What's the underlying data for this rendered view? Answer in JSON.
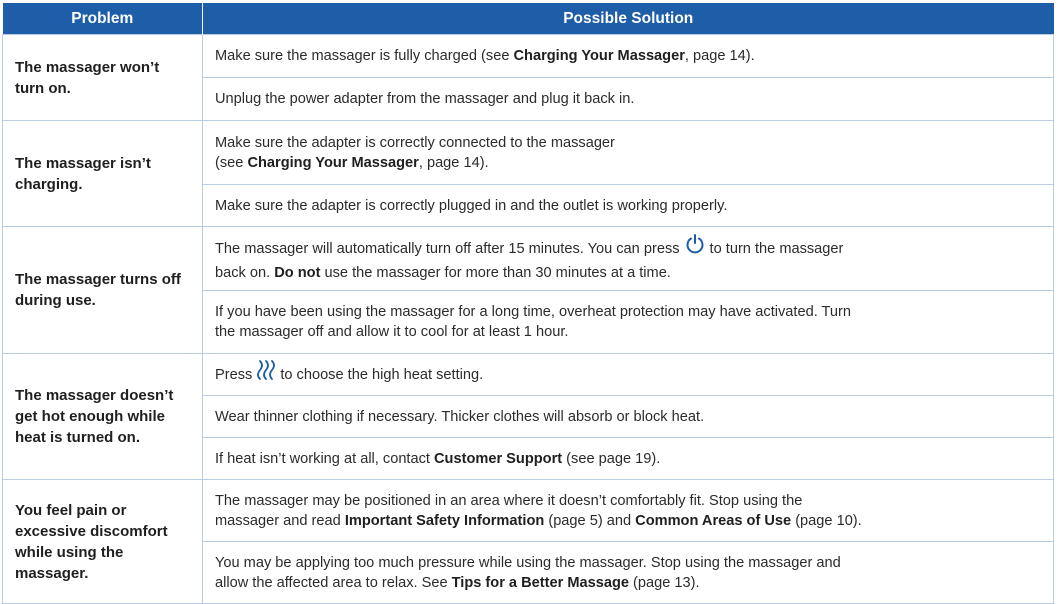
{
  "header": {
    "problem": "Problem",
    "solution": "Possible Solution"
  },
  "rows": [
    {
      "problem": "The massager won’t turn on.",
      "solutions": [
        {
          "t1": "Make sure the massager is fully charged (see ",
          "b1": "Charging Your Massager",
          "t2": ", page 14)."
        },
        {
          "t1": "Unplug the power adapter from the massager and plug it back in."
        }
      ]
    },
    {
      "problem": "The massager isn’t charging.",
      "solutions": [
        {
          "t1": "Make sure the adapter is correctly connected to the massager",
          "t2": "(see ",
          "b1": "Charging Your Massager",
          "t3": ", page 14)."
        },
        {
          "t1": "Make sure the adapter is correctly plugged in and the outlet is working properly."
        }
      ]
    },
    {
      "problem": "The massager turns off during use.",
      "solutions": [
        {
          "t1": "The massager will automatically turn off after 15 minutes. You can press",
          "icon": "power-icon",
          "t2": "to turn the massager",
          "t3": "back on. ",
          "b1": "Do not",
          "t4": " use the massager for more than 30 minutes at a time."
        },
        {
          "t1": "If you have been using the massager for a long time, overheat protection may have activated. Turn",
          "t2": "the massager off and allow it to cool for at least 1 hour."
        }
      ]
    },
    {
      "problem": "The massager doesn’t get hot enough while heat is turned on.",
      "solutions": [
        {
          "t1": "Press",
          "icon": "heat-icon",
          "t2": "to choose the high heat setting."
        },
        {
          "t1": "Wear thinner clothing if necessary. Thicker clothes will absorb or block heat."
        },
        {
          "t1": "If heat isn’t working at all, contact ",
          "b1": "Customer Support",
          "t2": " (see page 19)."
        }
      ]
    },
    {
      "problem": "You feel pain or excessive discomfort while using the massager.",
      "solutions": [
        {
          "t1": "The massager may be positioned in an area where it doesn’t comfortably fit. Stop using the",
          "t2": "massager and read ",
          "b1": "Important Safety Information",
          "t3": " (page 5) and ",
          "b2": "Common Areas of Use",
          "t4": " (page 10)."
        },
        {
          "t1": "You may be applying too much pressure while using the massager. Stop using the massager and",
          "t2": "allow the affected area to relax. See ",
          "b1": "Tips for a Better Massage",
          "t3": " (page 13)."
        }
      ]
    }
  ],
  "colors": {
    "header_bg": "#1e5da8",
    "border": "#b9cce3",
    "icon": "#1e5da8"
  }
}
